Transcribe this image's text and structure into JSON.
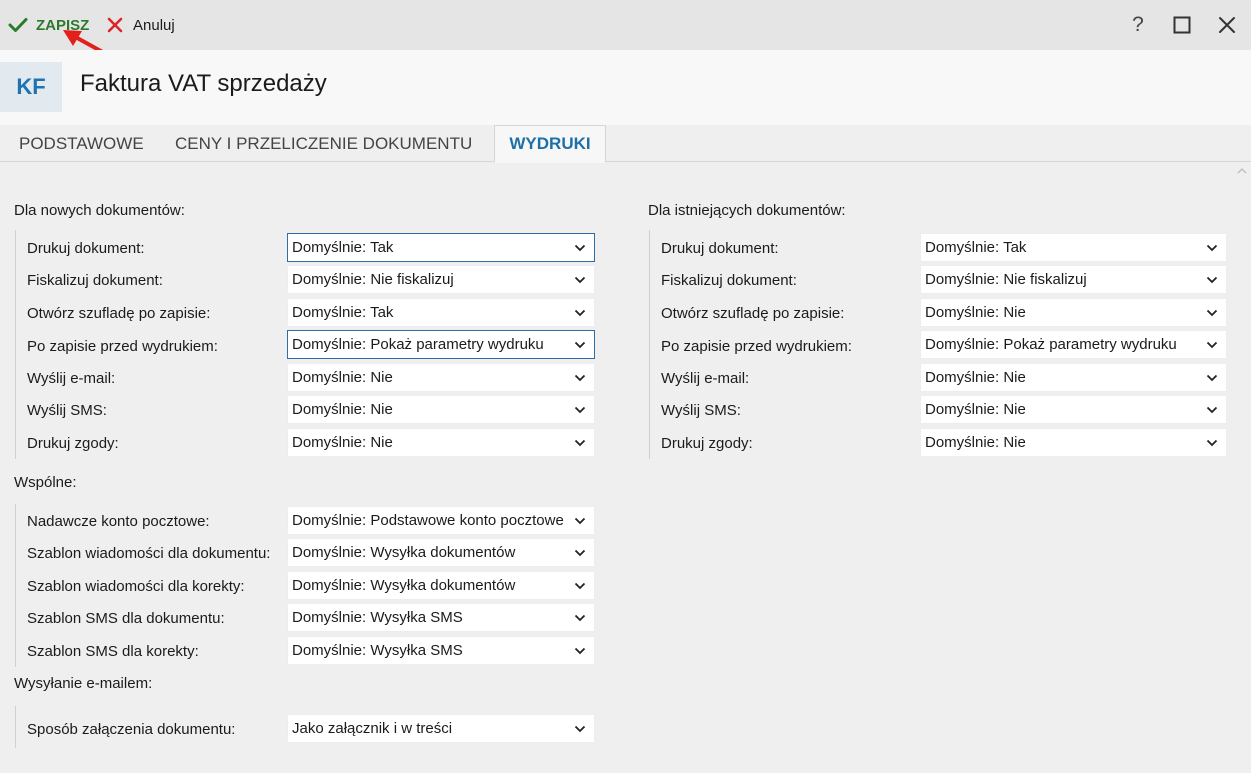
{
  "toolbar": {
    "save_label": "ZAPISZ",
    "cancel_label": "Anuluj",
    "help_glyph": "?"
  },
  "header": {
    "badge": "KF",
    "title": "Faktura VAT sprzedaży"
  },
  "tabs": [
    {
      "label": "PODSTAWOWE",
      "active": false
    },
    {
      "label": "CENY I PRZELICZENIE DOKUMENTU",
      "active": false
    },
    {
      "label": "WYDRUKI",
      "active": true
    }
  ],
  "new_docs": {
    "title": "Dla nowych dokumentów:",
    "rows": [
      {
        "label": "Drukuj dokument:",
        "value": "Domyślnie: Tak"
      },
      {
        "label": "Fiskalizuj dokument:",
        "value": "Domyślnie: Nie fiskalizuj"
      },
      {
        "label": "Otwórz szufladę po zapisie:",
        "value": "Domyślnie: Tak"
      },
      {
        "label": "Po zapisie przed wydrukiem:",
        "value": "Domyślnie: Pokaż parametry wydruku"
      },
      {
        "label": "Wyślij e-mail:",
        "value": "Domyślnie: Nie"
      },
      {
        "label": "Wyślij SMS:",
        "value": "Domyślnie: Nie"
      },
      {
        "label": "Drukuj zgody:",
        "value": "Domyślnie: Nie"
      }
    ]
  },
  "existing_docs": {
    "title": "Dla istniejących dokumentów:",
    "rows": [
      {
        "label": "Drukuj dokument:",
        "value": "Domyślnie: Tak"
      },
      {
        "label": "Fiskalizuj dokument:",
        "value": "Domyślnie: Nie fiskalizuj"
      },
      {
        "label": "Otwórz szufladę po zapisie:",
        "value": "Domyślnie: Nie"
      },
      {
        "label": "Po zapisie przed wydrukiem:",
        "value": "Domyślnie: Pokaż parametry wydruku"
      },
      {
        "label": "Wyślij e-mail:",
        "value": "Domyślnie: Nie"
      },
      {
        "label": "Wyślij SMS:",
        "value": "Domyślnie: Nie"
      },
      {
        "label": "Drukuj zgody:",
        "value": "Domyślnie: Nie"
      }
    ]
  },
  "common": {
    "title": "Wspólne:",
    "rows": [
      {
        "label": "Nadawcze konto pocztowe:",
        "value": "Domyślnie: Podstawowe konto pocztowe"
      },
      {
        "label": "Szablon wiadomości dla dokumentu:",
        "value": "Domyślnie: Wysyłka dokumentów"
      },
      {
        "label": "Szablon wiadomości dla korekty:",
        "value": "Domyślnie: Wysyłka dokumentów"
      },
      {
        "label": "Szablon SMS dla dokumentu:",
        "value": "Domyślnie: Wysyłka SMS"
      },
      {
        "label": "Szablon SMS dla korekty:",
        "value": "Domyślnie: Wysyłka SMS"
      }
    ]
  },
  "email_sending": {
    "title": "Wysyłanie e-mailem:",
    "rows": [
      {
        "label": "Sposób załączenia dokumentu:",
        "value": "Jako załącznik i w treści"
      }
    ]
  },
  "colors": {
    "accent": "#1e6fa8",
    "save": "#2d7a2d",
    "cancel": "#d9262c",
    "annotation": "#e3211c"
  },
  "icons": {
    "save": "checkmark-icon",
    "cancel": "x-icon",
    "help": "help-icon",
    "maximize": "maximize-icon",
    "close": "close-icon",
    "dropdown": "chevron-down-icon"
  }
}
